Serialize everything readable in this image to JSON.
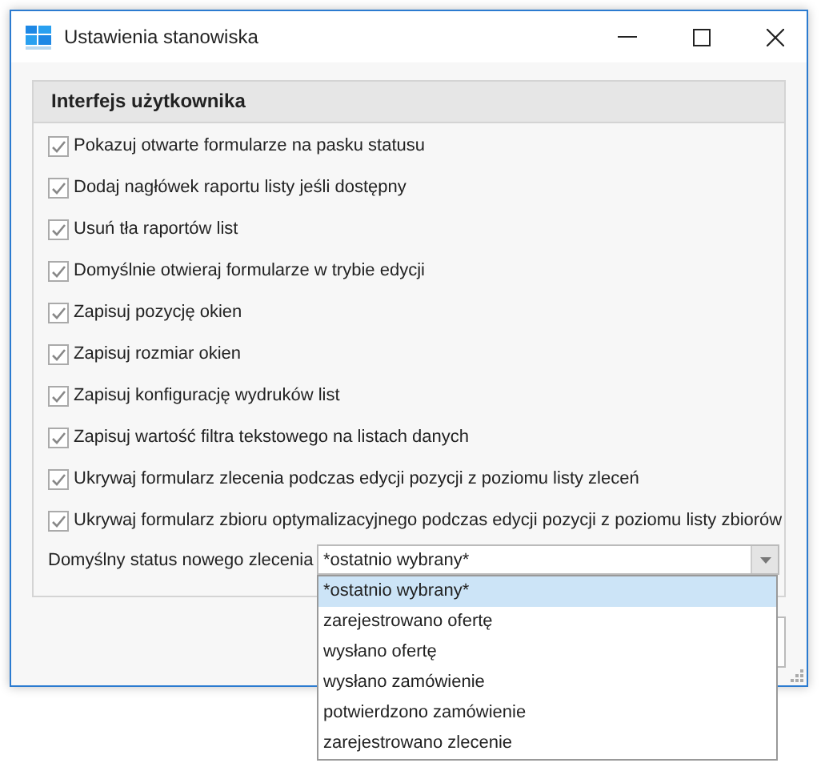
{
  "window": {
    "title": "Ustawienia stanowiska"
  },
  "group": {
    "title": "Interfejs użytkownika",
    "options": [
      {
        "label": "Pokazuj otwarte formularze na pasku statusu",
        "checked": true
      },
      {
        "label": "Dodaj nagłówek raportu listy jeśli dostępny",
        "checked": true
      },
      {
        "label": "Usuń tła raportów list",
        "checked": true
      },
      {
        "label": "Domyślnie otwieraj formularze w trybie edycji",
        "checked": true
      },
      {
        "label": "Zapisuj pozycję okien",
        "checked": true
      },
      {
        "label": "Zapisuj rozmiar okien",
        "checked": true
      },
      {
        "label": "Zapisuj konfigurację wydruków list",
        "checked": true
      },
      {
        "label": "Zapisuj wartość filtra tekstowego na listach danych",
        "checked": true
      },
      {
        "label": "Ukrywaj formularz zlecenia podczas edycji pozycji z poziomu listy zleceń",
        "checked": true
      },
      {
        "label": "Ukrywaj formularz zbioru optymalizacyjnego podczas edycji pozycji z poziomu listy zbiorów",
        "checked": true
      }
    ],
    "status_field": {
      "label": "Domyślny status nowego zlecenia",
      "value": "*ostatnio wybrany*",
      "options": [
        {
          "label": "*ostatnio wybrany*",
          "selected": true
        },
        {
          "label": "zarejestrowano ofertę",
          "selected": false
        },
        {
          "label": "wysłano ofertę",
          "selected": false
        },
        {
          "label": "wysłano zamówienie",
          "selected": false
        },
        {
          "label": "potwierdzono zamówienie",
          "selected": false
        },
        {
          "label": "zarejestrowano zlecenie",
          "selected": false
        }
      ]
    }
  }
}
